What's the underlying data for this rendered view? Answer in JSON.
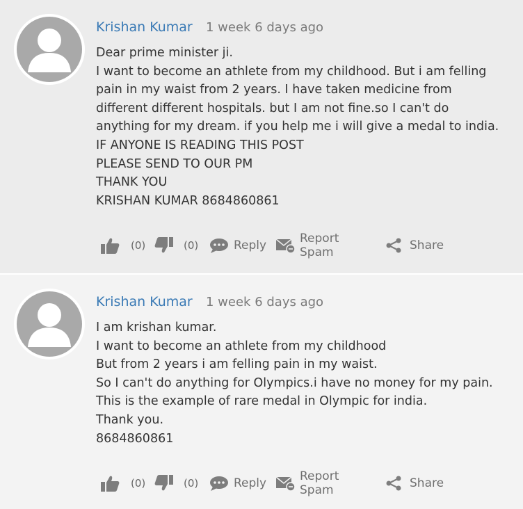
{
  "comments": [
    {
      "author": "Krishan Kumar",
      "time": "1 week 6 days ago",
      "lines": [
        "Dear prime minister ji.",
        "I want to become an athlete from my childhood. But i am felling",
        "pain in my waist from 2 years. I have taken medicine from",
        "different different hospitals. but I am not fine.so I can't do",
        "anything for my dream. if you help me i will give a medal to india.",
        "IF ANYONE IS READING THIS POST",
        "PLEASE SEND TO OUR PM",
        "THANK YOU",
        "KRISHAN KUMAR 8684860861"
      ],
      "likes": "(0)",
      "dislikes": "(0)",
      "reply": "Reply",
      "report": "Report Spam",
      "share": "Share"
    },
    {
      "author": "Krishan Kumar",
      "time": "1 week 6 days ago",
      "lines": [
        "I am krishan kumar.",
        "I want to become an athlete from my childhood",
        "But from 2 years i am felling pain in my waist.",
        "So I can't do anything for Olympics.i have no money for my pain.",
        "This is the example of rare medal in Olympic for india.",
        "Thank you.",
        "8684860861"
      ],
      "likes": "(0)",
      "dislikes": "(0)",
      "reply": "Reply",
      "report": "Report Spam",
      "share": "Share"
    }
  ],
  "icons": {
    "avatar": "default-user-avatar",
    "like": "thumbs-up-icon",
    "dislike": "thumbs-down-icon",
    "reply": "speech-bubble-icon",
    "report": "envelope-flag-icon",
    "share": "share-icon"
  },
  "colors": {
    "author": "#3a7ab5",
    "icon": "#7d7d7d"
  }
}
